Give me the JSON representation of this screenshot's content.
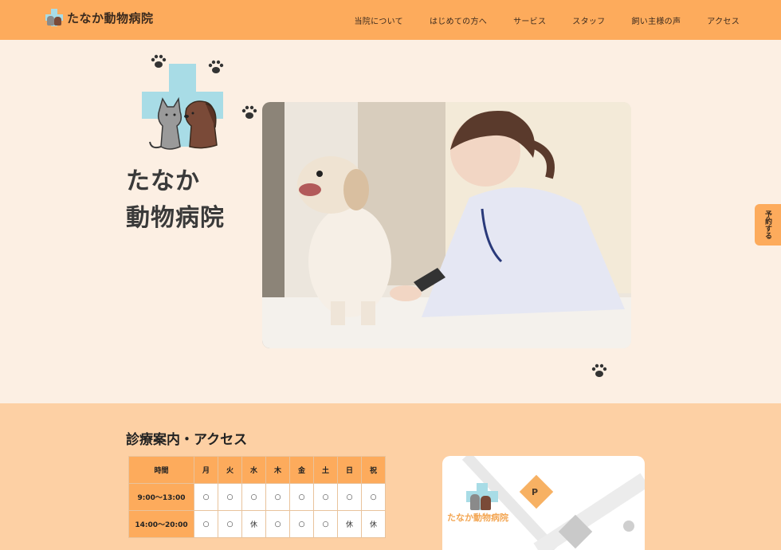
{
  "brand": {
    "name": "たなか動物病院"
  },
  "nav": {
    "items": [
      "当院について",
      "はじめての方へ",
      "サービス",
      "スタッフ",
      "飼い主様の声",
      "アクセス"
    ]
  },
  "hero": {
    "title_line1": "たなか",
    "title_line2": "動物病院",
    "photo_desc": "veterinarian trimming a small white dog"
  },
  "reserve_tab": {
    "label": "予約する"
  },
  "access": {
    "title": "診療案内・アクセス",
    "table": {
      "header": [
        "時間",
        "月",
        "火",
        "水",
        "木",
        "金",
        "土",
        "日",
        "祝"
      ],
      "rows": [
        [
          "9:00〜13:00",
          "○",
          "○",
          "○",
          "○",
          "○",
          "○",
          "○",
          "○"
        ],
        [
          "14:00〜20:00",
          "○",
          "○",
          "休",
          "○",
          "○",
          "○",
          "休",
          "休"
        ]
      ]
    },
    "map": {
      "name": "たなか動物病院",
      "parking": "P"
    }
  },
  "colors": {
    "header": "#fdab5c",
    "hero_bg": "#fcefe3",
    "section_bg": "#fdd0a4",
    "cross": "#a8dce6"
  },
  "icons": [
    "paw-icon",
    "logo-icon",
    "parking-icon"
  ]
}
